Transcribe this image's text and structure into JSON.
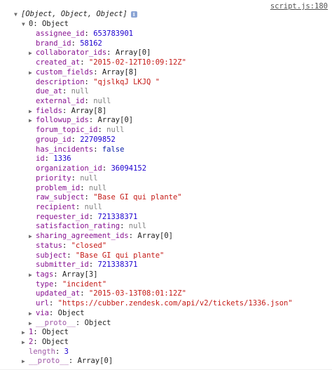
{
  "source_link": "script.js:180",
  "summary_label": "[Object, Object, Object]",
  "info_icon_glyph": "i",
  "root_item": {
    "label": "0: Object"
  },
  "fields": [
    {
      "key": "assignee_id",
      "value": "653783901",
      "type": "num",
      "expandable": false
    },
    {
      "key": "brand_id",
      "value": "58162",
      "type": "num",
      "expandable": false
    },
    {
      "key": "collaborator_ids",
      "value": "Array[0]",
      "type": "obj",
      "expandable": true
    },
    {
      "key": "created_at",
      "value": "\"2015-02-12T10:09:12Z\"",
      "type": "str",
      "expandable": false
    },
    {
      "key": "custom_fields",
      "value": "Array[8]",
      "type": "obj",
      "expandable": true
    },
    {
      "key": "description",
      "value": "\"qjslkqJ LKJQ \"",
      "type": "str",
      "expandable": false
    },
    {
      "key": "due_at",
      "value": "null",
      "type": "null",
      "expandable": false
    },
    {
      "key": "external_id",
      "value": "null",
      "type": "null",
      "expandable": false
    },
    {
      "key": "fields",
      "value": "Array[8]",
      "type": "obj",
      "expandable": true
    },
    {
      "key": "followup_ids",
      "value": "Array[0]",
      "type": "obj",
      "expandable": true
    },
    {
      "key": "forum_topic_id",
      "value": "null",
      "type": "null",
      "expandable": false
    },
    {
      "key": "group_id",
      "value": "22709852",
      "type": "num",
      "expandable": false
    },
    {
      "key": "has_incidents",
      "value": "false",
      "type": "bool",
      "expandable": false
    },
    {
      "key": "id",
      "value": "1336",
      "type": "num",
      "expandable": false
    },
    {
      "key": "organization_id",
      "value": "36094152",
      "type": "num",
      "expandable": false
    },
    {
      "key": "priority",
      "value": "null",
      "type": "null",
      "expandable": false
    },
    {
      "key": "problem_id",
      "value": "null",
      "type": "null",
      "expandable": false
    },
    {
      "key": "raw_subject",
      "value": "\"Base GI qui plante\"",
      "type": "str",
      "expandable": false
    },
    {
      "key": "recipient",
      "value": "null",
      "type": "null",
      "expandable": false
    },
    {
      "key": "requester_id",
      "value": "721338371",
      "type": "num",
      "expandable": false
    },
    {
      "key": "satisfaction_rating",
      "value": "null",
      "type": "null",
      "expandable": false
    },
    {
      "key": "sharing_agreement_ids",
      "value": "Array[0]",
      "type": "obj",
      "expandable": true
    },
    {
      "key": "status",
      "value": "\"closed\"",
      "type": "str",
      "expandable": false
    },
    {
      "key": "subject",
      "value": "\"Base GI qui plante\"",
      "type": "str",
      "expandable": false
    },
    {
      "key": "submitter_id",
      "value": "721338371",
      "type": "num",
      "expandable": false
    },
    {
      "key": "tags",
      "value": "Array[3]",
      "type": "obj",
      "expandable": true
    },
    {
      "key": "type",
      "value": "\"incident\"",
      "type": "str",
      "expandable": false
    },
    {
      "key": "updated_at",
      "value": "\"2015-03-13T08:01:12Z\"",
      "type": "str",
      "expandable": false
    },
    {
      "key": "url",
      "value": "\"https://cubber.zendesk.com/api/v2/tickets/1336.json\"",
      "type": "str",
      "expandable": false
    },
    {
      "key": "via",
      "value": "Object",
      "type": "obj",
      "expandable": true
    },
    {
      "key": "__proto__",
      "value": "Object",
      "type": "obj",
      "expandable": true,
      "dim": true
    }
  ],
  "tail_items": [
    {
      "key": "1",
      "value": "Object",
      "type": "obj",
      "expandable": true,
      "dim": false
    },
    {
      "key": "2",
      "value": "Object",
      "type": "obj",
      "expandable": true,
      "dim": false
    },
    {
      "key": "length",
      "value": "3",
      "type": "num",
      "expandable": false,
      "dim": true
    },
    {
      "key": "__proto__",
      "value": "Array[0]",
      "type": "obj",
      "expandable": true,
      "dim": true
    }
  ],
  "colors": {
    "key": "#881391",
    "number": "#1c00cf",
    "string": "#c41a16",
    "null": "#808080",
    "boolean": "#0d22aa"
  }
}
